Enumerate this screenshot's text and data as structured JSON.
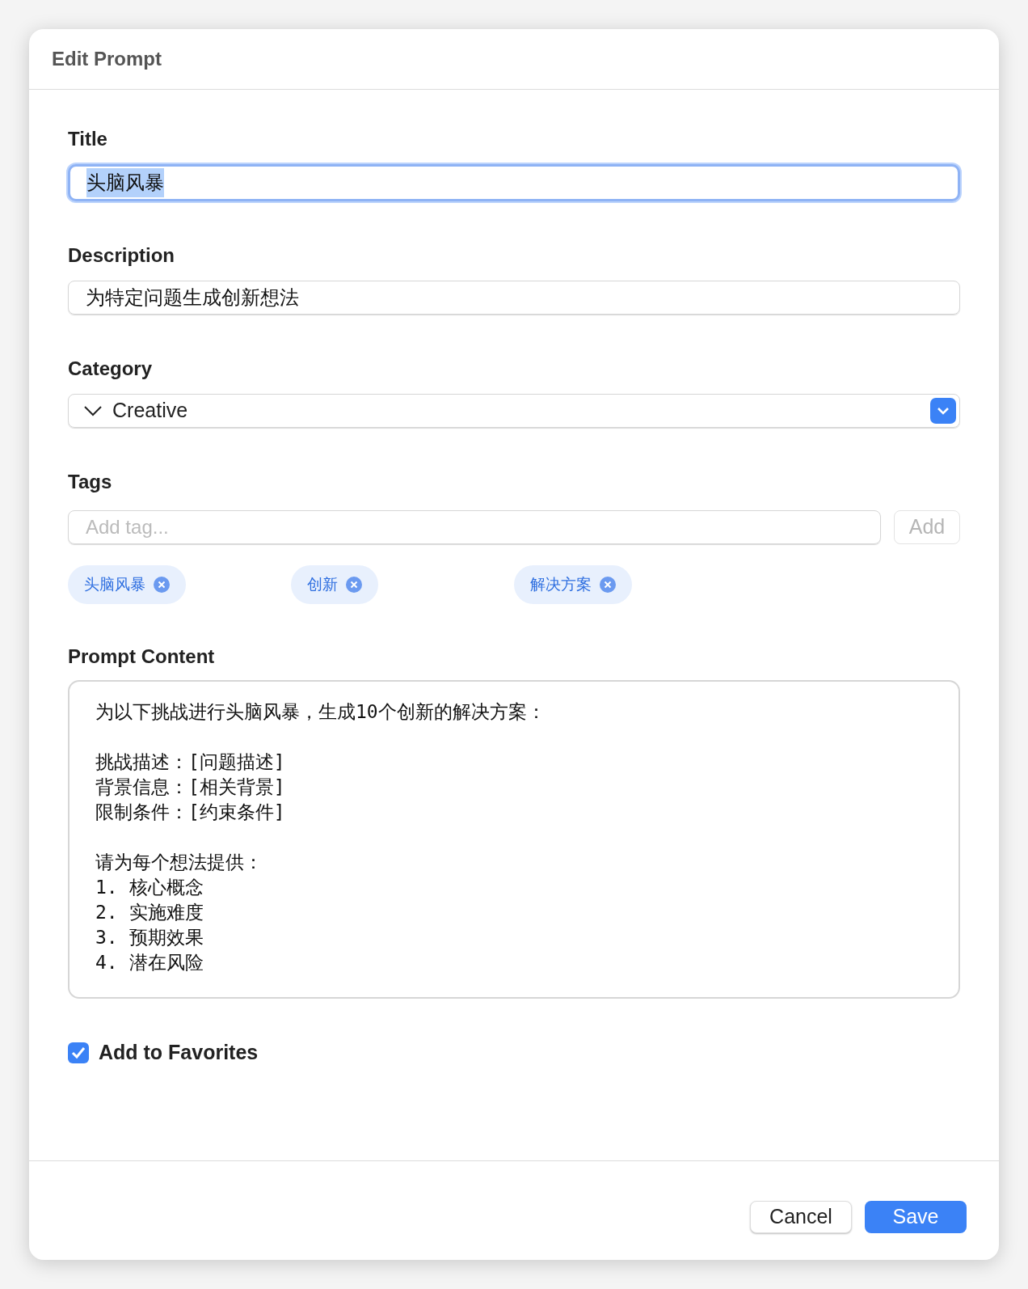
{
  "window": {
    "title": "Edit Prompt"
  },
  "title_field": {
    "label": "Title",
    "value": "头脑风暴",
    "focused": true,
    "text_selected": true
  },
  "description_field": {
    "label": "Description",
    "value": "为特定问题生成创新想法"
  },
  "category": {
    "label": "Category",
    "value": "Creative"
  },
  "tags": {
    "label": "Tags",
    "placeholder": "Add tag...",
    "add_button": "Add",
    "add_disabled": true,
    "items": [
      {
        "label": "头脑风暴"
      },
      {
        "label": "创新"
      },
      {
        "label": "解决方案"
      }
    ]
  },
  "prompt_content": {
    "label": "Prompt Content",
    "paragraphs": [
      [
        "为以下挑战进行头脑风暴，生成10个创新的解决方案："
      ],
      [
        "挑战描述：[问题描述]",
        "背景信息：[相关背景]",
        "限制条件：[约束条件]"
      ],
      [
        "请为每个想法提供：",
        "1. 核心概念",
        "2. 实施难度",
        "3. 预期效果",
        "4. 潜在风险"
      ]
    ]
  },
  "favorite": {
    "label": "Add to Favorites",
    "checked": true
  },
  "buttons": [
    {
      "label": "Cancel",
      "kind": "secondary"
    },
    {
      "label": "Save",
      "kind": "primary"
    }
  ]
}
